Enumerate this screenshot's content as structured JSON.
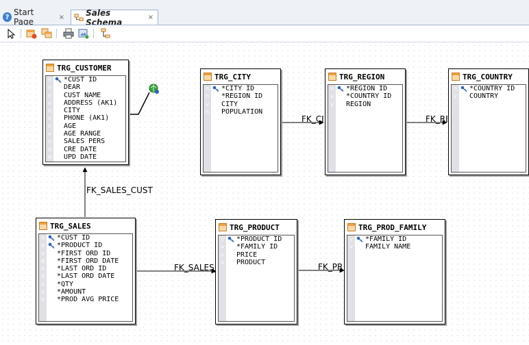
{
  "tabs": [
    {
      "label": "Start Page",
      "close": "×"
    },
    {
      "label": "Sales Schema",
      "close": "×"
    }
  ],
  "toolbar": {
    "buttons": [
      "select-pointer-icon",
      "add-table-icon",
      "copy-table-icon",
      "print-icon",
      "export-image-icon",
      "layout-icon"
    ]
  },
  "tables": [
    {
      "name": "TRG_CUSTOMER",
      "columns": [
        {
          "tag": "n",
          "key": true,
          "name": "*CUST ID"
        },
        {
          "tag": "v",
          "key": false,
          "name": "DEAR"
        },
        {
          "tag": "v",
          "key": false,
          "name": "CUST NAME"
        },
        {
          "tag": "v",
          "key": false,
          "name": "ADDRESS (AK1)"
        },
        {
          "tag": "v",
          "key": false,
          "name": "CITY"
        },
        {
          "tag": "v",
          "key": false,
          "name": "PHONE (AK1)"
        },
        {
          "tag": "n",
          "key": false,
          "name": "AGE"
        },
        {
          "tag": "v",
          "key": false,
          "name": "AGE RANGE"
        },
        {
          "tag": "v",
          "key": false,
          "name": "SALES PERS"
        },
        {
          "tag": "d",
          "key": false,
          "name": "CRE DATE"
        },
        {
          "tag": "d",
          "key": false,
          "name": "UPD DATE"
        }
      ]
    },
    {
      "name": "TRG_CITY",
      "columns": [
        {
          "tag": "n",
          "key": true,
          "name": "*CITY ID"
        },
        {
          "tag": "n",
          "key": false,
          "name": "*REGION ID"
        },
        {
          "tag": "v",
          "key": false,
          "name": "CITY"
        },
        {
          "tag": "n",
          "key": false,
          "name": "POPULATION"
        }
      ]
    },
    {
      "name": "TRG_REGION",
      "columns": [
        {
          "tag": "n",
          "key": true,
          "name": "*REGION ID"
        },
        {
          "tag": "v",
          "key": false,
          "name": "*COUNTRY ID"
        },
        {
          "tag": "v",
          "key": false,
          "name": "REGION"
        }
      ]
    },
    {
      "name": "TRG_COUNTRY",
      "columns": [
        {
          "tag": "n",
          "key": true,
          "name": "*COUNTRY ID"
        },
        {
          "tag": "v",
          "key": false,
          "name": "COUNTRY"
        }
      ]
    },
    {
      "name": "TRG_SALES",
      "columns": [
        {
          "tag": "n",
          "key": true,
          "name": "*CUST ID"
        },
        {
          "tag": "n",
          "key": true,
          "name": "*PRODUCT ID"
        },
        {
          "tag": "n",
          "key": false,
          "name": "*FIRST ORD ID"
        },
        {
          "tag": "d",
          "key": false,
          "name": "*FIRST ORD DATE"
        },
        {
          "tag": "n",
          "key": false,
          "name": "*LAST ORD ID"
        },
        {
          "tag": "d",
          "key": false,
          "name": "*LAST ORD DATE"
        },
        {
          "tag": "n",
          "key": false,
          "name": "*QTY"
        },
        {
          "tag": "n",
          "key": false,
          "name": "*AMOUNT"
        },
        {
          "tag": "n",
          "key": false,
          "name": "*PROD AVG PRICE"
        }
      ]
    },
    {
      "name": "TRG_PRODUCT",
      "columns": [
        {
          "tag": "n",
          "key": true,
          "name": "*PRODUCT ID"
        },
        {
          "tag": "v",
          "key": false,
          "name": "*FAMILY ID"
        },
        {
          "tag": "n",
          "key": false,
          "name": "PRICE"
        },
        {
          "tag": "v",
          "key": false,
          "name": "PRODUCT"
        }
      ]
    },
    {
      "name": "TRG_PROD_FAMILY",
      "columns": [
        {
          "tag": "v",
          "key": true,
          "name": "*FAMILY ID"
        },
        {
          "tag": "v",
          "key": false,
          "name": "FAMILY NAME"
        }
      ]
    }
  ],
  "relationships": [
    {
      "label": "FK_SALES_CUST"
    },
    {
      "label": "FK_CITY"
    },
    {
      "label": "FK_REGION"
    },
    {
      "label": "FK_SALES_PROD"
    },
    {
      "label": "FK_PROD_FAMILY"
    }
  ],
  "colors": {
    "column_type_gutter": "#dfe1e6",
    "tab_border": "#9fb3cf",
    "connector_green": "#3aa53a"
  }
}
